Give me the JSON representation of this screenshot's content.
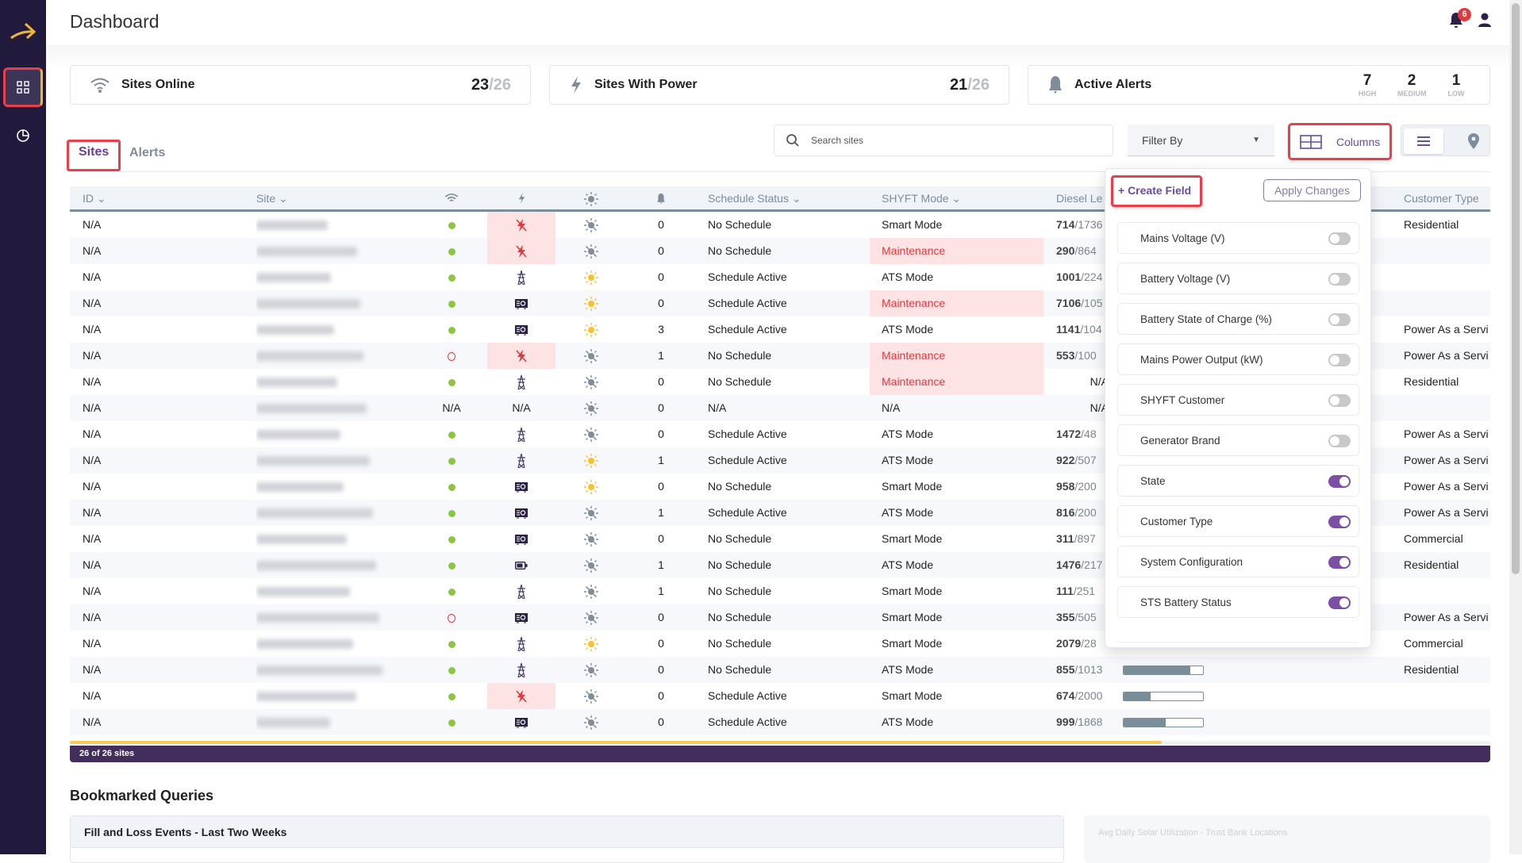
{
  "header": {
    "title": "Dashboard",
    "notifications_count": "6"
  },
  "summary": {
    "sites_online": {
      "label": "Sites Online",
      "value": "23",
      "total": "/26"
    },
    "sites_with_power": {
      "label": "Sites With Power",
      "value": "21",
      "total": "/26"
    },
    "active_alerts": {
      "label": "Active Alerts",
      "high": "7",
      "high_label": "HIGH",
      "medium": "2",
      "medium_label": "MEDIUM",
      "low": "1",
      "low_label": "LOW"
    }
  },
  "tabs": [
    {
      "label": "Sites",
      "active": true
    },
    {
      "label": "Alerts",
      "active": false
    }
  ],
  "toolbar": {
    "search_placeholder": "Search sites",
    "filter_label": "Filter By",
    "columns_label": "Columns"
  },
  "table": {
    "headers": {
      "id": "ID",
      "site": "Site",
      "schedule": "Schedule Status",
      "mode": "SHYFT Mode",
      "diesel": "Diesel Le",
      "customer": "Customer Type"
    },
    "rows": [
      {
        "id": "N/A",
        "online": "on",
        "power": "off",
        "solar": "inactive",
        "alerts": "0",
        "schedule": "No Schedule",
        "mode": "Smart Mode",
        "diesel": "714",
        "diesel_total": "/1736",
        "customer": "Residential"
      },
      {
        "id": "N/A",
        "online": "on",
        "power": "off",
        "solar": "inactive",
        "alerts": "0",
        "schedule": "No Schedule",
        "mode": "Maintenance",
        "diesel": "290",
        "diesel_total": "/864",
        "customer": ""
      },
      {
        "id": "N/A",
        "online": "on",
        "power": "grid",
        "solar": "active",
        "alerts": "0",
        "schedule": "Schedule Active",
        "mode": "ATS Mode",
        "diesel": "1001",
        "diesel_total": "/224",
        "customer": ""
      },
      {
        "id": "N/A",
        "online": "on",
        "power": "generator",
        "solar": "active",
        "alerts": "0",
        "schedule": "Schedule Active",
        "mode": "Maintenance",
        "diesel": "7106",
        "diesel_total": "/105",
        "customer": ""
      },
      {
        "id": "N/A",
        "online": "on",
        "power": "generator",
        "solar": "active",
        "alerts": "3",
        "schedule": "Schedule Active",
        "mode": "ATS Mode",
        "diesel": "1141",
        "diesel_total": "/104",
        "customer": "Power As a Servi"
      },
      {
        "id": "N/A",
        "online": "off",
        "power": "off",
        "solar": "inactive",
        "alerts": "1",
        "schedule": "No Schedule",
        "mode": "Maintenance",
        "diesel": "553",
        "diesel_total": "/100",
        "customer": "Power As a Servi"
      },
      {
        "id": "N/A",
        "online": "on",
        "power": "grid",
        "solar": "inactive",
        "alerts": "0",
        "schedule": "No Schedule",
        "mode": "Maintenance",
        "diesel": "N/A",
        "diesel_total": "",
        "customer": "Residential"
      },
      {
        "id": "N/A",
        "online": "N/A",
        "power": "N/A",
        "solar": "inactive",
        "alerts": "0",
        "schedule": "N/A",
        "mode": "N/A",
        "diesel": "N/A",
        "diesel_total": "",
        "customer": ""
      },
      {
        "id": "N/A",
        "online": "on",
        "power": "grid",
        "solar": "inactive",
        "alerts": "0",
        "schedule": "Schedule Active",
        "mode": "ATS Mode",
        "diesel": "1472",
        "diesel_total": "/48",
        "customer": "Power As a Servi"
      },
      {
        "id": "N/A",
        "online": "on",
        "power": "grid",
        "solar": "active",
        "alerts": "1",
        "schedule": "Schedule Active",
        "mode": "ATS Mode",
        "diesel": "922",
        "diesel_total": "/507",
        "customer": "Power As a Servi"
      },
      {
        "id": "N/A",
        "online": "on",
        "power": "generator",
        "solar": "active",
        "alerts": "0",
        "schedule": "No Schedule",
        "mode": "Smart Mode",
        "diesel": "958",
        "diesel_total": "/200",
        "customer": "Power As a Servi"
      },
      {
        "id": "N/A",
        "online": "on",
        "power": "generator",
        "solar": "inactive",
        "alerts": "1",
        "schedule": "Schedule Active",
        "mode": "ATS Mode",
        "diesel": "816",
        "diesel_total": "/200",
        "customer": "Power As a Servi"
      },
      {
        "id": "N/A",
        "online": "on",
        "power": "generator",
        "solar": "inactive",
        "alerts": "0",
        "schedule": "No Schedule",
        "mode": "Smart Mode",
        "diesel": "311",
        "diesel_total": "/897",
        "customer": "Commercial"
      },
      {
        "id": "N/A",
        "online": "on",
        "power": "battery",
        "solar": "inactive",
        "alerts": "1",
        "schedule": "No Schedule",
        "mode": "ATS Mode",
        "diesel": "1476",
        "diesel_total": "/217",
        "customer": "Residential"
      },
      {
        "id": "N/A",
        "online": "on",
        "power": "grid",
        "solar": "inactive",
        "alerts": "1",
        "schedule": "No Schedule",
        "mode": "Smart Mode",
        "diesel": "111",
        "diesel_total": "/251",
        "customer": ""
      },
      {
        "id": "N/A",
        "online": "off",
        "power": "generator",
        "solar": "inactive",
        "alerts": "0",
        "schedule": "No Schedule",
        "mode": "Smart Mode",
        "diesel": "355",
        "diesel_total": "/505",
        "customer": "Power As a Servi"
      },
      {
        "id": "N/A",
        "online": "on",
        "power": "grid",
        "solar": "active",
        "alerts": "0",
        "schedule": "No Schedule",
        "mode": "Smart Mode",
        "diesel": "2079",
        "diesel_total": "/28",
        "customer": "Commercial"
      },
      {
        "id": "N/A",
        "online": "on",
        "power": "grid",
        "solar": "inactive",
        "alerts": "0",
        "schedule": "No Schedule",
        "mode": "ATS Mode",
        "diesel": "855",
        "diesel_total": "/1013",
        "diesel_fill": 0.84,
        "customer": "Residential"
      },
      {
        "id": "N/A",
        "online": "on",
        "power": "off",
        "solar": "inactive",
        "alerts": "0",
        "schedule": "Schedule Active",
        "mode": "Smart Mode",
        "diesel": "674",
        "diesel_total": "/2000",
        "diesel_fill": 0.34,
        "customer": ""
      },
      {
        "id": "N/A",
        "online": "on",
        "power": "generator",
        "solar": "inactive",
        "alerts": "0",
        "schedule": "Schedule Active",
        "mode": "ATS Mode",
        "diesel": "999",
        "diesel_total": "/1868",
        "diesel_fill": 0.53,
        "customer": ""
      }
    ],
    "footer": "26 of 26 sites"
  },
  "columns_popup": {
    "create_label": "+ Create Field",
    "apply_label": "Apply Changes",
    "options": [
      {
        "label": "Mains Voltage (V)",
        "on": false
      },
      {
        "label": "Battery Voltage (V)",
        "on": false
      },
      {
        "label": "Battery State of Charge (%)",
        "on": false
      },
      {
        "label": "Mains Power Output (kW)",
        "on": false
      },
      {
        "label": "SHYFT Customer",
        "on": false
      },
      {
        "label": "Generator Brand",
        "on": false
      },
      {
        "label": "State",
        "on": true
      },
      {
        "label": "Customer Type",
        "on": true
      },
      {
        "label": "System Configuration",
        "on": true
      },
      {
        "label": "STS Battery Status",
        "on": true
      }
    ]
  },
  "bookmarks": {
    "title": "Bookmarked Queries",
    "cards": [
      "Fill and Loss Events - Last Two Weeks",
      "Avg Daily Solar Utilization - Trust Bank Locations"
    ]
  },
  "colors": {
    "sidebar": "#211a3d",
    "accent": "#7b4fa6",
    "footer": "#432d5d",
    "alert_bg": "#fde3e4",
    "alert_text": "#e0393e",
    "online": "#8cc63f",
    "solar_active": "#fbc02d"
  }
}
